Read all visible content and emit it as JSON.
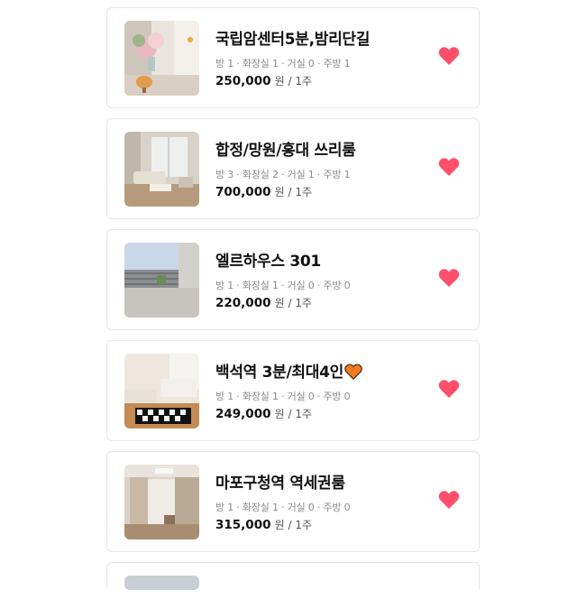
{
  "listings": [
    {
      "title": "국립암센터5분,밤리단길",
      "specs": "방 1 · 화장실 1 · 거실 0 · 주방 1",
      "price": "250,000",
      "unit": "원 / 1주",
      "favorited": true,
      "photo": "room-flowers-lamp"
    },
    {
      "title": "합정/망원/홍대 쓰리룸",
      "specs": "방 3 · 화장실 2 · 거실 1 · 주방 1",
      "price": "700,000",
      "unit": "원 / 1주",
      "favorited": true,
      "photo": "living-room-sofa"
    },
    {
      "title": "엘르하우스 301",
      "specs": "방 1 · 화장실 1 · 거실 0 · 주방 0",
      "price": "220,000",
      "unit": "원 / 1주",
      "favorited": true,
      "photo": "balcony-terrace"
    },
    {
      "title": "백석역 3분/최대4인",
      "title_emoji": "orange-heart",
      "specs": "방 1 · 화장실 1 · 거실 0 · 주방 0",
      "price": "249,000",
      "unit": "원 / 1주",
      "favorited": true,
      "photo": "bedroom-checkered-rug"
    },
    {
      "title": "마포구청역 역세권룸",
      "specs": "방 1 · 화장실 1 · 거실 0 · 주방 0",
      "price": "315,000",
      "unit": "원 / 1주",
      "favorited": true,
      "photo": "room-curtains-window"
    }
  ],
  "colors": {
    "heart": "#ff4f6a",
    "emoji_heart": "#f47a1f",
    "border": "#e6e6e6"
  }
}
